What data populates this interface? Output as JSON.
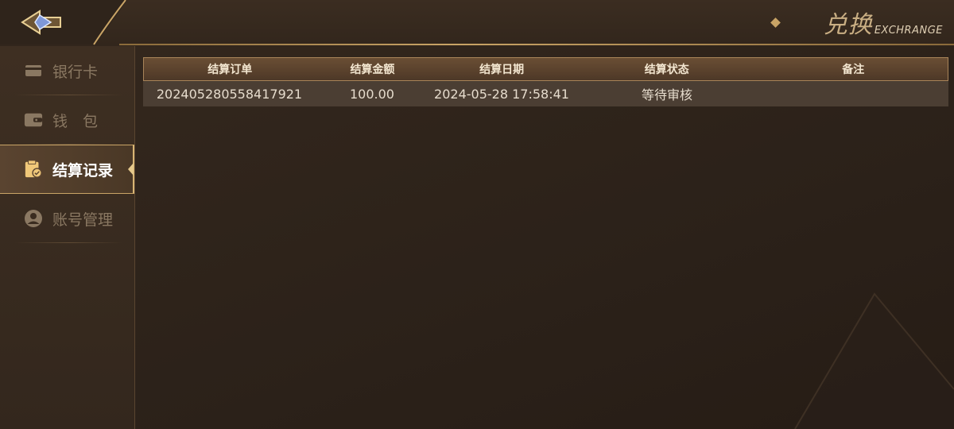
{
  "header": {
    "title": "兑换",
    "subtitle": "EXCHRANGE"
  },
  "sidebar": {
    "items": [
      {
        "label": "银行卡",
        "icon": "bank-card-icon",
        "active": false
      },
      {
        "label": "钱　包",
        "icon": "wallet-icon",
        "active": false
      },
      {
        "label": "结算记录",
        "icon": "settlement-record-icon",
        "active": true
      },
      {
        "label": "账号管理",
        "icon": "account-icon",
        "active": false
      }
    ]
  },
  "table": {
    "columns": [
      "结算订单",
      "结算金额",
      "结算日期",
      "结算状态",
      "备注"
    ],
    "rows": [
      [
        "202405280558417921",
        "100.00",
        "2024-05-28 17:58:41",
        "等待审核",
        ""
      ]
    ]
  },
  "colors": {
    "accent_gold": "#c9a466",
    "background": "#2e231a",
    "active_text": "#ffffff",
    "inactive_text": "#8a7862"
  }
}
